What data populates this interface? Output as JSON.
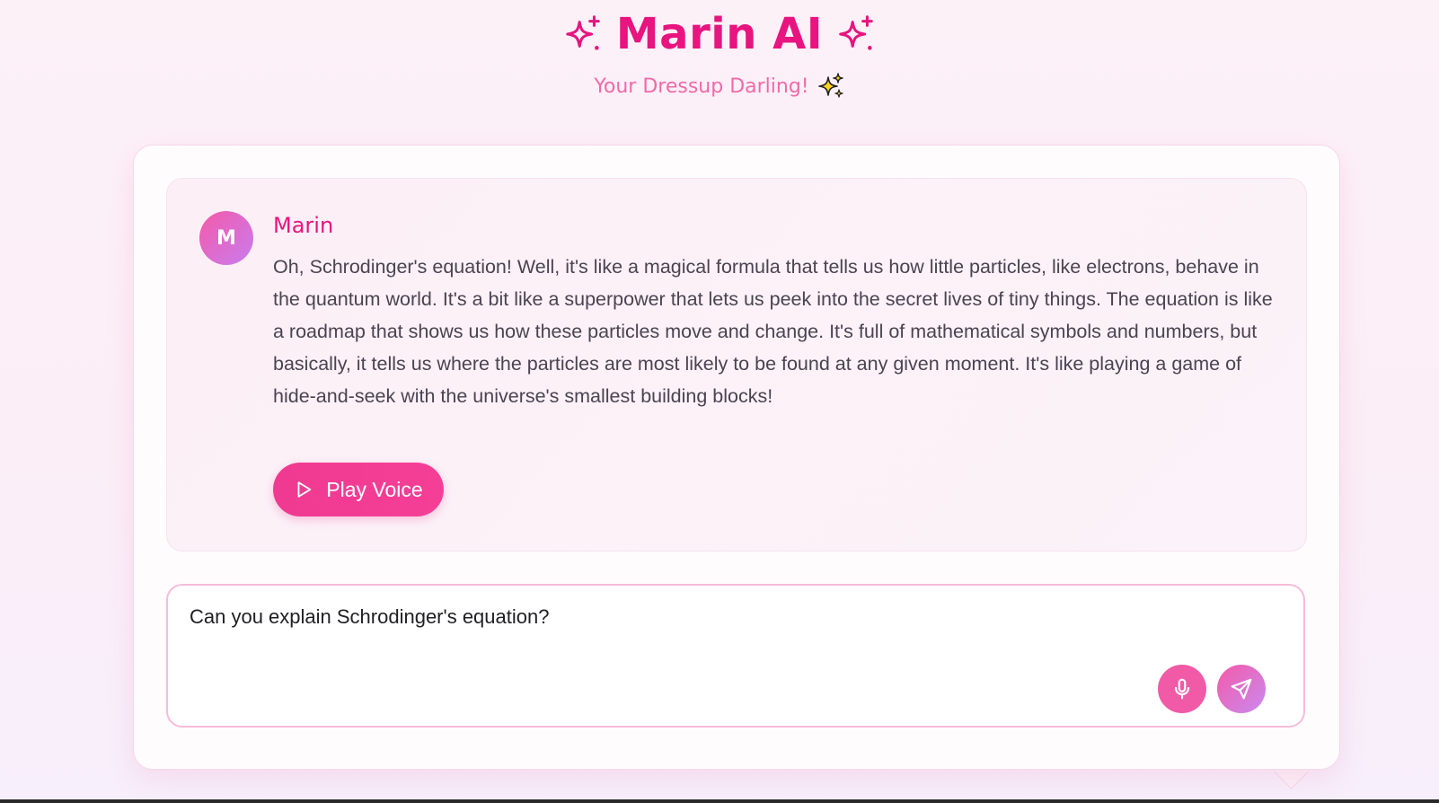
{
  "header": {
    "title": "Marin AI",
    "subtitle": "Your Dressup Darling!",
    "title_icon_left": "sparkles-icon",
    "title_icon_right": "sparkles-icon",
    "subtitle_icon": "sparkles-emoji-icon"
  },
  "chat": {
    "messages": [
      {
        "avatar_initial": "M",
        "sender": "Marin",
        "text": "Oh, Schrodinger's equation! Well, it's like a magical formula that tells us how little particles, like electrons, behave in the quantum world. It's a bit like a superpower that lets us peek into the secret lives of tiny things. The equation is like a roadmap that shows us how these particles move and change. It's full of mathematical symbols and numbers, but basically, it tells us where the particles are most likely to be found at any given moment. It's like playing a game of hide-and-seek with the universe's smallest building blocks!",
        "play_label": "Play Voice",
        "play_icon": "play-icon"
      }
    ]
  },
  "composer": {
    "value": "Can you explain Schrodinger's equation?",
    "mic_icon": "microphone-icon",
    "send_icon": "send-icon"
  },
  "colors": {
    "accent": "#e8147f",
    "subtitle": "#f06aa8",
    "button": "#f03a92",
    "gradient_end": "#c97cf0"
  }
}
